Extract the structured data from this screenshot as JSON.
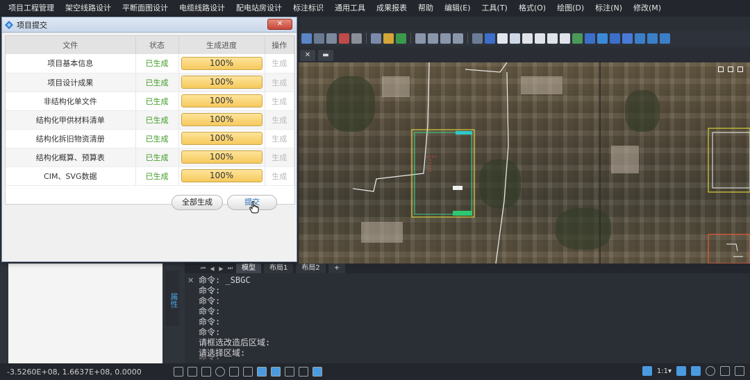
{
  "menu": [
    "项目工程管理",
    "架空线路设计",
    "平断面图设计",
    "电缆线路设计",
    "配电站房设计",
    "标注标识",
    "通用工具",
    "成果报表",
    "帮助",
    "编辑(E)",
    "工具(T)",
    "格式(O)",
    "绘图(D)",
    "标注(N)",
    "修改(M)"
  ],
  "dialog": {
    "title": "项目提交",
    "close_label": "✕",
    "headers": {
      "file": "文件",
      "status": "状态",
      "progress": "生成进度",
      "op": "操作"
    },
    "rows": [
      {
        "file": "项目基本信息",
        "status": "已生成",
        "progress": "100%",
        "op": "生成"
      },
      {
        "file": "项目设计成果",
        "status": "已生成",
        "progress": "100%",
        "op": "生成"
      },
      {
        "file": "非结构化单文件",
        "status": "已生成",
        "progress": "100%",
        "op": "生成"
      },
      {
        "file": "结构化甲供材料清单",
        "status": "已生成",
        "progress": "100%",
        "op": "生成"
      },
      {
        "file": "结构化拆旧物资清册",
        "status": "已生成",
        "progress": "100%",
        "op": "生成"
      },
      {
        "file": "结构化概算、预算表",
        "status": "已生成",
        "progress": "100%",
        "op": "生成"
      },
      {
        "file": "CIM、SVG数据",
        "status": "已生成",
        "progress": "100%",
        "op": "生成"
      }
    ],
    "buttons": {
      "generate_all": "全部生成",
      "submit": "提交"
    }
  },
  "layout_tabs": {
    "model": "模型",
    "layout1": "布局1",
    "layout2": "布局2",
    "add": "+"
  },
  "side_tab": "属性",
  "command": {
    "lines": [
      "命令: _SBGC",
      "命令:",
      "命令:",
      "命令:",
      "命令:",
      "命令:",
      "请框选改造后区域:",
      "请选择区域:"
    ],
    "prompt": "命令:"
  },
  "status": {
    "coords": "-3.5260E+08, 1.6637E+08, 0.0000",
    "scale": "1:1▾"
  },
  "colors": {
    "accent": "#4aa3e0",
    "status_green": "#3c9a22",
    "progress_fill": "#f5c95d"
  }
}
